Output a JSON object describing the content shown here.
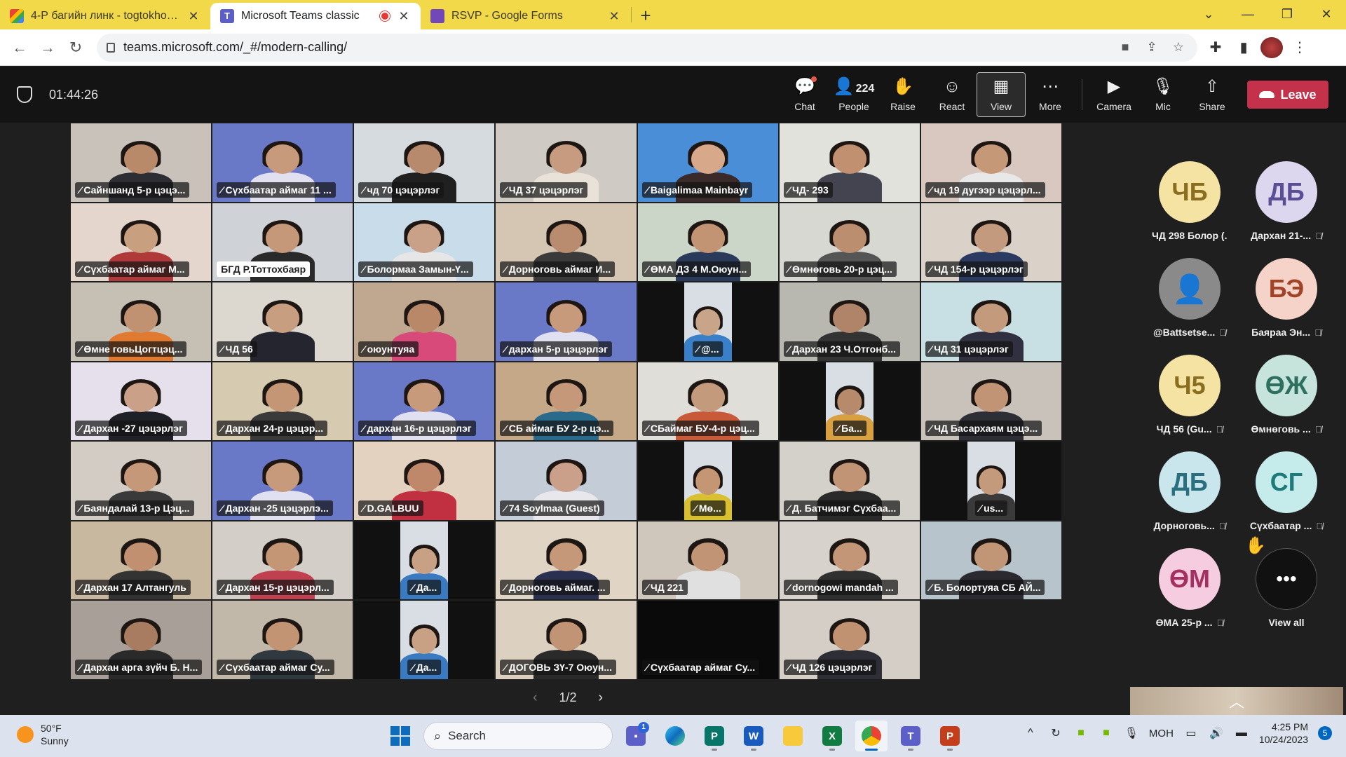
{
  "browser": {
    "tabs": [
      {
        "title": "4-Р багийн линк - togtokhoo.b",
        "icon": "gmail-icon"
      },
      {
        "title": "Microsoft Teams classic",
        "icon": "teams-icon",
        "recording": true
      },
      {
        "title": "RSVP - Google Forms",
        "icon": "forms-icon"
      }
    ],
    "url": "teams.microsoft.com/_#/modern-calling/"
  },
  "meeting": {
    "timer": "01:44:26",
    "controls": {
      "chat": "Chat",
      "people": "People",
      "people_count": "224",
      "raise": "Raise",
      "react": "React",
      "view": "View",
      "more": "More",
      "camera": "Camera",
      "mic": "Mic",
      "share": "Share",
      "leave": "Leave"
    }
  },
  "tiles": [
    {
      "name": "Сайншанд 5-р цэцэ...",
      "bg": "#c9c2bb",
      "skin": "#b98a6a",
      "shirt": "#2d2d34"
    },
    {
      "name": "Сүхбаатар аймаг 11 ...",
      "bg": "#6a78c8",
      "skin": "#c89a7c",
      "shirt": "#e0e0f0"
    },
    {
      "name": "чд 70 цэцэрлэг",
      "bg": "#d6dbe0",
      "skin": "#b78a6e",
      "shirt": "#202020"
    },
    {
      "name": "ЧД 37 цэцэрлэг",
      "bg": "#cfcac4",
      "skin": "#c69b80",
      "shirt": "#e8e2d8"
    },
    {
      "name": "Baigalimaa Mainbayr",
      "bg": "#4a8ed8",
      "skin": "#d7a88a",
      "shirt": "#3a2a2a"
    },
    {
      "name": "ЧД- 293",
      "bg": "#e2e2dc",
      "skin": "#c09070",
      "shirt": "#444450"
    },
    {
      "name": "чд 19 дугээр цэцэрл...",
      "bg": "#d8c8c0",
      "skin": "#c59878",
      "shirt": "#e8e8e8"
    },
    {
      "name": "Сүхбаатар аймаг М...",
      "bg": "#e4d6cc",
      "skin": "#c8a080",
      "shirt": "#b03a3a"
    },
    {
      "name": "БГД Р.Тоттохбаяр",
      "bg": "#cfd3d8",
      "skin": "#c49878",
      "shirt": "#2a2a2a",
      "light": true
    },
    {
      "name": "Болормаа Замын-Ү...",
      "bg": "#c8dcea",
      "skin": "#c9a088",
      "shirt": "#e6e6e6"
    },
    {
      "name": "Дорноговь аймаг И...",
      "bg": "#d4c6b2",
      "skin": "#b98c70",
      "shirt": "#3a3a3a"
    },
    {
      "name": "ӨМА ДЗ 4 М.Оюун...",
      "bg": "#cbd6c8",
      "skin": "#c29474",
      "shirt": "#2a3a5a"
    },
    {
      "name": "Өмнөговь 20-р цэц...",
      "bg": "#d8d8d2",
      "skin": "#bb8e70",
      "shirt": "#555"
    },
    {
      "name": "ЧД 154-р цэцэрлэг",
      "bg": "#dad2c8",
      "skin": "#c49a7e",
      "shirt": "#2a3a60"
    },
    {
      "name": "Өмне говьЦогтцэц...",
      "bg": "#c6c0b4",
      "skin": "#c09272",
      "shirt": "#e07a30"
    },
    {
      "name": "ЧД 56",
      "bg": "#dcd8d0",
      "skin": "#c89e80",
      "shirt": "#252530"
    },
    {
      "name": "оюунтуяа",
      "bg": "#c0a890",
      "skin": "#b88868",
      "shirt": "#d84a7a"
    },
    {
      "name": "дархан 5-р цэцэрлэг",
      "bg": "#6a78c8",
      "skin": "#c89a7c",
      "shirt": "#e0e0f0"
    },
    {
      "name": "@...",
      "bg": "#111111",
      "skin": "#c8a488",
      "shirt": "#3a80c8",
      "center": true
    },
    {
      "name": "Дархан 23 Ч.Отгонб...",
      "bg": "#b8b8b0",
      "skin": "#b08468",
      "shirt": "#333"
    },
    {
      "name": "ЧД 31 цэцэрлэг",
      "bg": "#c8e0e4",
      "skin": "#c49a7c",
      "shirt": "#303040"
    },
    {
      "name": "Дархан -27 цэцэрлэг",
      "bg": "#e6e0ec",
      "skin": "#caa088",
      "shirt": "#202028"
    },
    {
      "name": "Дархан 24-р цэцэр...",
      "bg": "#d6cab0",
      "skin": "#c49676",
      "shirt": "#3a3a3a"
    },
    {
      "name": "дархан 16-р цэцэрлэг",
      "bg": "#6a78c8",
      "skin": "#c89a7c",
      "shirt": "#e0e0f0"
    },
    {
      "name": "СБ аймаг БУ 2-р цэ...",
      "bg": "#c4a888",
      "skin": "#c49878",
      "shirt": "#2a6a8a"
    },
    {
      "name": "СБаймаг БУ-4-р цэц...",
      "bg": "#e0ded8",
      "skin": "#c49a7c",
      "shirt": "#c85a3a"
    },
    {
      "name": "Ба...",
      "bg": "#111111",
      "skin": "#b88a6c",
      "shirt": "#d8a040",
      "center": true
    },
    {
      "name": "ЧД Басархаям цэцэ...",
      "bg": "#c8c2ba",
      "skin": "#c09474",
      "shirt": "#2e2e36"
    },
    {
      "name": "Баяндалай 13-р Цэц...",
      "bg": "#d2ccc4",
      "skin": "#c49878",
      "shirt": "#3a3a3a"
    },
    {
      "name": "Дархан -25 цэцэрлэ...",
      "bg": "#6a78c8",
      "skin": "#c89a7c",
      "shirt": "#e0e0f0"
    },
    {
      "name": "D.GALBUU",
      "bg": "#e4d2c0",
      "skin": "#c0886a",
      "shirt": "#c03040"
    },
    {
      "name": "74 Soylmaa (Guest)",
      "bg": "#c4ccd8",
      "skin": "#caa08a",
      "shirt": "#e8e8ec"
    },
    {
      "name": "Мө...",
      "bg": "#111111",
      "skin": "#c49674",
      "shirt": "#d8c030",
      "center": true
    },
    {
      "name": "Д. Батчимэг Сүхбаа...",
      "bg": "#d4d0ca",
      "skin": "#c09474",
      "shirt": "#2a2a2a"
    },
    {
      "name": "us...",
      "bg": "#111111",
      "skin": "#c49a7c",
      "shirt": "#3a3a3a",
      "center": true
    },
    {
      "name": "Дархан 17 Алтангуль",
      "bg": "#c8b8a0",
      "skin": "#c09070",
      "shirt": "#333"
    },
    {
      "name": "Дархан 15-р цэцэрл...",
      "bg": "#d4cec8",
      "skin": "#c49676",
      "shirt": "#c04050"
    },
    {
      "name": "Да...",
      "bg": "#111111",
      "skin": "#c8a084",
      "shirt": "#3a7ac0",
      "center": true
    },
    {
      "name": "Дорноговь аймаг. ...",
      "bg": "#e0d4c4",
      "skin": "#c49878",
      "shirt": "#2a3050"
    },
    {
      "name": "ЧД 221",
      "bg": "#cfc6bc",
      "skin": "#c09474",
      "shirt": "#e0e0e0"
    },
    {
      "name": "dornogowi mandah ...",
      "bg": "#d8d2cc",
      "skin": "#c29676",
      "shirt": "#303030"
    },
    {
      "name": "Б. Болортуяа СБ АЙ...",
      "bg": "#b8c4cc",
      "skin": "#c09676",
      "shirt": "#2a2a30"
    },
    {
      "name": "Дархан арга зүйч Б. Н...",
      "bg": "#a8a098",
      "skin": "#a87c60",
      "shirt": "#2a2a2a",
      "light": false
    },
    {
      "name": "Сүхбаатар аймаг Су...",
      "bg": "#c2b8aa",
      "skin": "#c29474",
      "shirt": "#303840"
    },
    {
      "name": "Да...",
      "bg": "#111111",
      "skin": "#c8a084",
      "shirt": "#3a7ac0",
      "center": true
    },
    {
      "name": "ДОГОВЬ ЗҮ-7 Оюун...",
      "bg": "#dcd0c0",
      "skin": "#c09474",
      "shirt": "#2a2a2a"
    },
    {
      "name": "Сүхбаатар аймаг Су...",
      "bg": "#0a0a0a",
      "skin": "",
      "shirt": "",
      "empty": true
    },
    {
      "name": "ЧД 126 цэцэрлэг",
      "bg": "#d4cec6",
      "skin": "#c09272",
      "shirt": "#2e2e36"
    }
  ],
  "roster": [
    {
      "initials": "ЧБ",
      "label": "ЧД 298 Болор (...",
      "color": "#f5e3a3",
      "text": "#8a6d1e",
      "muted": false
    },
    {
      "initials": "ДБ",
      "label": "Дархан 21-...",
      "color": "#dcd6ef",
      "text": "#5a4e94",
      "muted": true
    },
    {
      "initials": "",
      "label": "@Battsetse...",
      "color": "#8a8a8a",
      "text": "#ffffff",
      "muted": true,
      "generic": true
    },
    {
      "initials": "БЭ",
      "label": "Баяраа Эн...",
      "color": "#f6d3c9",
      "text": "#a14328",
      "muted": true
    },
    {
      "initials": "Ч5",
      "label": "ЧД 56 (Gu...",
      "color": "#f5e3a3",
      "text": "#8a6d1e",
      "muted": true
    },
    {
      "initials": "ӨЖ",
      "label": "Өмнөговь ...",
      "color": "#c7e4dc",
      "text": "#2e7060",
      "muted": true
    },
    {
      "initials": "ДБ",
      "label": "Дорноговь...",
      "color": "#c9e6ec",
      "text": "#2a6f80",
      "muted": true
    },
    {
      "initials": "СГ",
      "label": "Сүхбаатар ...",
      "color": "#c6ebeb",
      "text": "#1f7a7a",
      "muted": true
    },
    {
      "initials": "ӨМ",
      "label": "ӨМА 25-р ...",
      "color": "#f6cde0",
      "text": "#a3305f",
      "muted": true,
      "hand": true
    }
  ],
  "view_all": "View all",
  "pager": {
    "label": "1/2"
  },
  "taskbar": {
    "temp": "50°F",
    "condition": "Sunny",
    "search": "Search",
    "chat_badge": "1",
    "lang": "МОН",
    "time": "4:25 PM",
    "date": "10/24/2023",
    "notifications": "5"
  }
}
